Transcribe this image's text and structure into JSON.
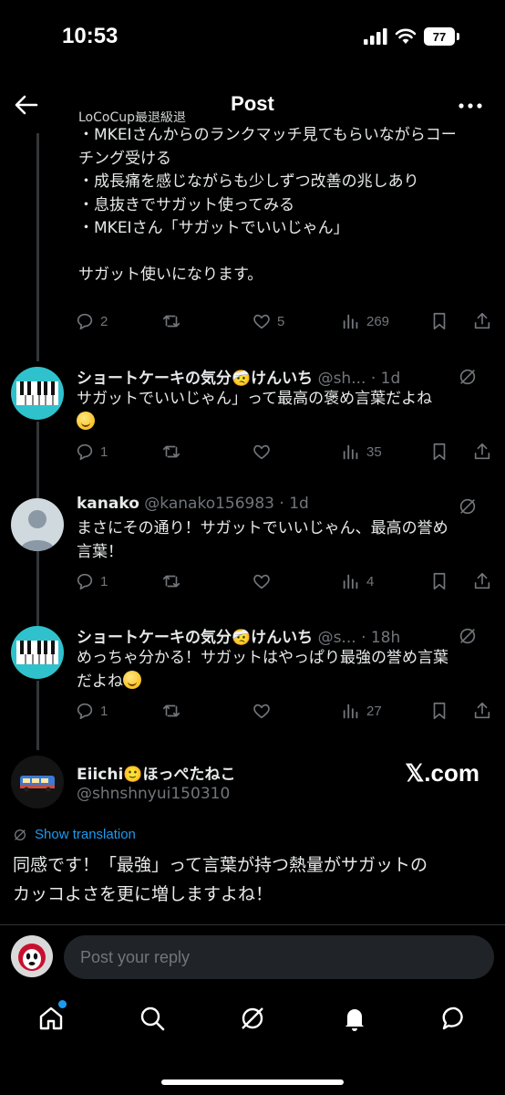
{
  "status_bar": {
    "time": "10:53",
    "battery": "77"
  },
  "header": {
    "title": "Post"
  },
  "main_post": {
    "cut_line": "LoCoCup最退級退",
    "lines": [
      "・MKEIさんからのランクマッチ見てもらいながらコー",
      "チング受ける",
      "・成長痛を感じながらも少しずつ改善の兆しあり",
      "・息抜きでサガット使ってみる",
      "・MKEIさん「サガットでいいじゃん」",
      "",
      "サガット使いになります。"
    ],
    "actions": {
      "replies": "2",
      "likes": "5",
      "views": "269"
    }
  },
  "replies": [
    {
      "name": "ショートケーキの気分🤕けんいち",
      "handle": "@sh...",
      "time": "· 1d",
      "text": "サガットでいいじゃん」って最高の褒め言葉だよね",
      "text2": "",
      "actions": {
        "replies": "1",
        "likes": "",
        "views": "35"
      }
    },
    {
      "name": "kanako",
      "handle": "@kanako156983",
      "time": "· 1d",
      "text": "まさにその通り！サガットでいいじゃん、最高の誉め",
      "text2": "言葉！",
      "actions": {
        "replies": "1",
        "likes": "",
        "views": "4"
      }
    },
    {
      "name": "ショートケーキの気分🤕けんいち",
      "handle": "@s...",
      "time": "· 18h",
      "text": "めっちゃ分かる！サガットはやっぱり最強の誉め言葉",
      "text2": "だよね",
      "actions": {
        "replies": "1",
        "likes": "",
        "views": "27"
      }
    }
  ],
  "reference_post": {
    "name": "Eiichi🙂ほっぺたねこ",
    "handle": "@shnshnyui150310",
    "source": "𝕏.com",
    "translate_label": "Show translation",
    "text_lines": [
      "同感です！「最強」って言葉が持つ熱量がサガットの",
      "カッコよさを更に増しますよね！"
    ]
  },
  "compose": {
    "placeholder": "Post your reply"
  },
  "colors": {
    "accent": "#1d9bf0",
    "muted": "#71767b",
    "text": "#e7e9ea",
    "background": "#000000"
  },
  "tabs": [
    "home-icon",
    "search-icon",
    "grok-icon",
    "notifications-icon",
    "messages-icon"
  ]
}
